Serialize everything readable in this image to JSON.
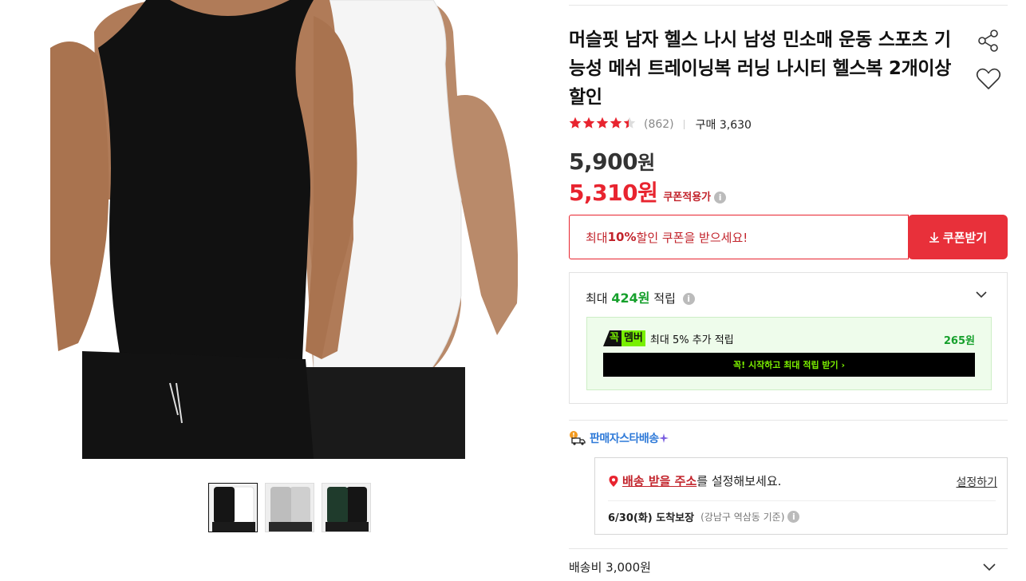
{
  "product": {
    "title": "머슬핏 남자 헬스 나시 남성 민소매 운동 스포츠 기능성 메쉬 트레이닝복 러닝 나시티 헬스복 2개이상 할인",
    "stars": "★★★★★",
    "rating": 4.5,
    "review_count": "(862)",
    "purchase_count": "구매 3,630",
    "price": "5,900",
    "price_unit": "원",
    "coupon_price": "5,310원",
    "coupon_price_label": "쿠폰적용가"
  },
  "icons": {
    "share": "share-icon",
    "wishlist": "heart-icon",
    "info": "info-icon",
    "chevron": "chevron-down-icon",
    "download": "download-arrow-icon",
    "delivery": "delivery-truck-icon",
    "location": "location-pin-icon"
  },
  "coupon": {
    "prefix": "최대 ",
    "rate": "10%",
    "suffix": " 할인 쿠폰을 받으세요!",
    "button_label": "쿠폰받기"
  },
  "points": {
    "prefix": "최대 ",
    "amount": "424원",
    "suffix": " 적립",
    "member_badge_1": "꼭",
    "member_badge_2": "멤버",
    "member_text": "최대 5% 추가 적립",
    "member_amount": "265원",
    "member_cta": "꼭! 시작하고 최대 적립 받기 ›"
  },
  "delivery": {
    "seller_star_label": "판매자스타배송",
    "address_link": "배송 받을 주소",
    "address_text": "를 설정해보세요.",
    "address_set": "설정하기",
    "arrival_date": "6/30(화) 도착보장",
    "arrival_location": "(강남구 역삼동 기준)",
    "shipping_fee": "배송비 3,000원"
  },
  "colors": {
    "accent_red": "#e8242f",
    "points_green": "#16a02c",
    "member_lime": "#78f000",
    "seller_blue": "#2f7ad8"
  }
}
